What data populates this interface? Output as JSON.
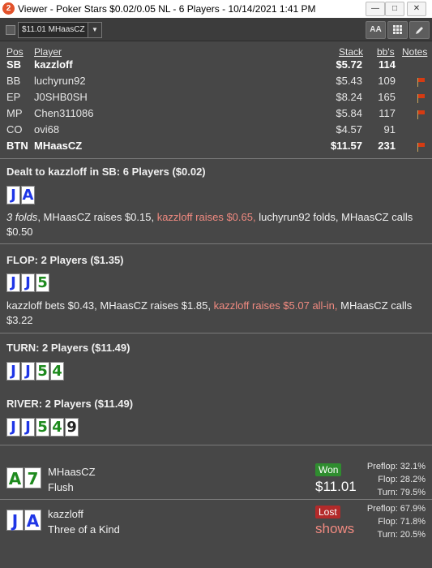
{
  "window": {
    "title": "Viewer - Poker Stars $0.02/0.05 NL - 6 Players - 10/14/2021 1:41 PM",
    "app_icon": "2"
  },
  "toolbar": {
    "hero_select": "$11.01 MHaasCZ",
    "font_btn": "AA"
  },
  "players_header": {
    "pos": "Pos",
    "player": "Player",
    "stack": "Stack",
    "bbs": "bb's",
    "notes": "Notes"
  },
  "players": [
    {
      "pos": "SB",
      "name": "kazzloff",
      "stack": "$5.72",
      "bbs": "114",
      "bold": true,
      "flag": false
    },
    {
      "pos": "BB",
      "name": "luchyrun92",
      "stack": "$5.43",
      "bbs": "109",
      "bold": false,
      "flag": true
    },
    {
      "pos": "EP",
      "name": "J0SHB0SH",
      "stack": "$8.24",
      "bbs": "165",
      "bold": false,
      "flag": true
    },
    {
      "pos": "MP",
      "name": "Chen311086",
      "stack": "$5.84",
      "bbs": "117",
      "bold": false,
      "flag": true
    },
    {
      "pos": "CO",
      "name": "ovi68",
      "stack": "$4.57",
      "bbs": "91",
      "bold": false,
      "flag": false
    },
    {
      "pos": "BTN",
      "name": "MHaasCZ",
      "stack": "$11.57",
      "bbs": "231",
      "bold": true,
      "flag": true
    }
  ],
  "colors": {
    "raise_highlight": "#f08a80",
    "won_badge": "#2f8d2f",
    "lost_badge": "#b32a2a",
    "flag": "#d63b12",
    "spades": "#1f36e6",
    "clubs": "#1e8a1e"
  },
  "preflop": {
    "title": "Dealt to kazzloff in SB: 6 Players ($0.02)",
    "cards": [
      {
        "rank": "J",
        "suit": "spades"
      },
      {
        "rank": "A",
        "suit": "spades"
      }
    ],
    "a1": "3 folds",
    "a2": ", MHaasCZ raises $0.15, ",
    "a3": "kazzloff raises $0.65,",
    "a4": " luchyrun92 folds, MHaasCZ calls $0.50"
  },
  "flop": {
    "title": "FLOP: 2 Players ($1.35)",
    "cards": [
      {
        "rank": "J",
        "suit": "spades"
      },
      {
        "rank": "J",
        "suit": "spades"
      },
      {
        "rank": "5",
        "suit": "clubs"
      }
    ],
    "a1": "kazzloff bets $0.43, MHaasCZ raises $1.85, ",
    "a2": "kazzloff raises $5.07 all-in,",
    "a3": " MHaasCZ calls $3.22"
  },
  "turn": {
    "title": "TURN: 2 Players ($11.49)",
    "cards": [
      {
        "rank": "J",
        "suit": "spades"
      },
      {
        "rank": "J",
        "suit": "spades"
      },
      {
        "rank": "5",
        "suit": "clubs"
      },
      {
        "rank": "4",
        "suit": "clubs"
      }
    ]
  },
  "river": {
    "title": "RIVER: 2 Players ($11.49)",
    "cards": [
      {
        "rank": "J",
        "suit": "spades"
      },
      {
        "rank": "J",
        "suit": "spades"
      },
      {
        "rank": "5",
        "suit": "clubs"
      },
      {
        "rank": "4",
        "suit": "clubs"
      },
      {
        "rank": "9",
        "suit": "black"
      }
    ]
  },
  "results": [
    {
      "name": "MHaasCZ",
      "hand": "Flush",
      "badge": "Won",
      "amount": "$11.01",
      "cards": [
        {
          "rank": "A",
          "suit": "clubs"
        },
        {
          "rank": "7",
          "suit": "clubs"
        }
      ],
      "eq": {
        "preflop": "Preflop: 32.1%",
        "flop": "Flop: 28.2%",
        "turn": "Turn: 79.5%"
      }
    },
    {
      "name": "kazzloff",
      "hand": "Three of a Kind",
      "badge": "Lost",
      "amount": "shows",
      "cards": [
        {
          "rank": "J",
          "suit": "spades"
        },
        {
          "rank": "A",
          "suit": "spades"
        }
      ],
      "eq": {
        "preflop": "Preflop: 67.9%",
        "flop": "Flop: 71.8%",
        "turn": "Turn: 20.5%"
      }
    }
  ]
}
